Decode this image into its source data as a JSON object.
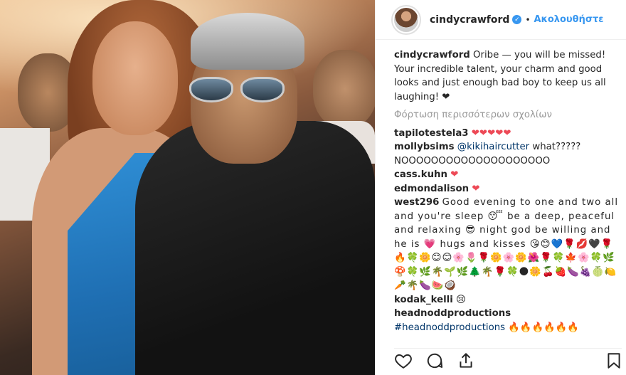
{
  "post": {
    "username": "cindycrawford",
    "verified_icon": "verified-badge-icon",
    "separator": "•",
    "follow_label": "Ακολουθήστε"
  },
  "caption": {
    "username": "cindycrawford",
    "text": "Oribe — you will be missed! Your incredible talent, your charm and good looks and just enough bad boy to keep us all laughing! ❤"
  },
  "load_more": "Φόρτωση περισσότερων σχολίων",
  "comments": [
    {
      "user": "tapilotestela3",
      "text": "❤❤❤❤❤"
    },
    {
      "user": "mollybsims",
      "mention": "@kikihaircutter",
      "text": " what????? NOOOOOOOOOOOOOOOOOOOO"
    },
    {
      "user": "cass.kuhn",
      "text": "❤"
    },
    {
      "user": "edmondalison",
      "text": "❤"
    },
    {
      "user": "west296",
      "text": "Good evening to one and two all and you're sleep 😴 be a deep, peaceful and relaxing 😎 night god be willing and he is 💗 hugs and kisses 😘😊💙🌹💋🖤🌹🔥🍀🌼😊😊🌸🌷🌹🌼🌸🌼🌺🌹🍀🍁🌸🍀🌿🍄🍀🌿🌴🌱🌿🌲🌴🌹🍀🌑🌼🍒🍓🍆🍇🍈🍋🥕🌴🍆🍉🥥"
    },
    {
      "user": "kodak_kelli",
      "text": "😢"
    },
    {
      "user": "headnoddproductions",
      "mention": "#headnoddproductions",
      "text": " 🔥🔥🔥🔥🔥🔥"
    }
  ],
  "actions": {
    "like_icon": "heart-icon",
    "comment_icon": "comment-icon",
    "share_icon": "share-icon",
    "save_icon": "bookmark-icon"
  }
}
